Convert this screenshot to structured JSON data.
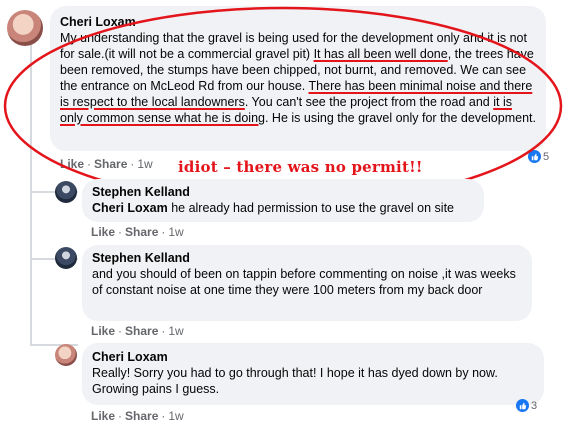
{
  "comments": [
    {
      "author": "Cheri Loxam",
      "text_parts": [
        "My understanding that the gravel is being used for the development only and it is not for sale.(it will not be a commercial gravel pit) ",
        "It has all been well done",
        ", the trees have been removed, the stumps have been chipped, not burnt, and removed. We can see the entrance on McLeod Rd from our house. ",
        "There has been minimal noise and there is respect to the local landowners",
        ". You can't see the project from the road and ",
        "it is only common sense what he is doing",
        ". He is using the gravel only for the development."
      ],
      "actions": {
        "like": "Like",
        "share": "Share",
        "time": "1w"
      },
      "reaction_count": "5"
    },
    {
      "author": "Stephen Kelland",
      "mention": "Cheri Loxam",
      "text": " he already had permission to use the gravel on site",
      "actions": {
        "like": "Like",
        "share": "Share",
        "time": "1w"
      }
    },
    {
      "author": "Stephen Kelland",
      "text": "and you should of been on tappin before commenting on noise ,it was weeks of constant noise at one time they were 100 meters from my back door",
      "actions": {
        "like": "Like",
        "share": "Share",
        "time": "1w"
      }
    },
    {
      "author": "Cheri Loxam",
      "text": "Really! Sorry you had to go through that! I hope it has dyed down by now. Growing pains I guess.",
      "actions": {
        "like": "Like",
        "share": "Share",
        "time": "1w"
      },
      "reaction_count": "3"
    }
  ],
  "annotation": {
    "text": "idiot – there was no permit!!",
    "color": "#e4141b"
  },
  "icons": {
    "reaction": "like-icon"
  },
  "colors": {
    "bubble": "#f0f2f5",
    "meta": "#65676b",
    "like_blue": "#1877f2",
    "annotation_red": "#e4141b"
  }
}
